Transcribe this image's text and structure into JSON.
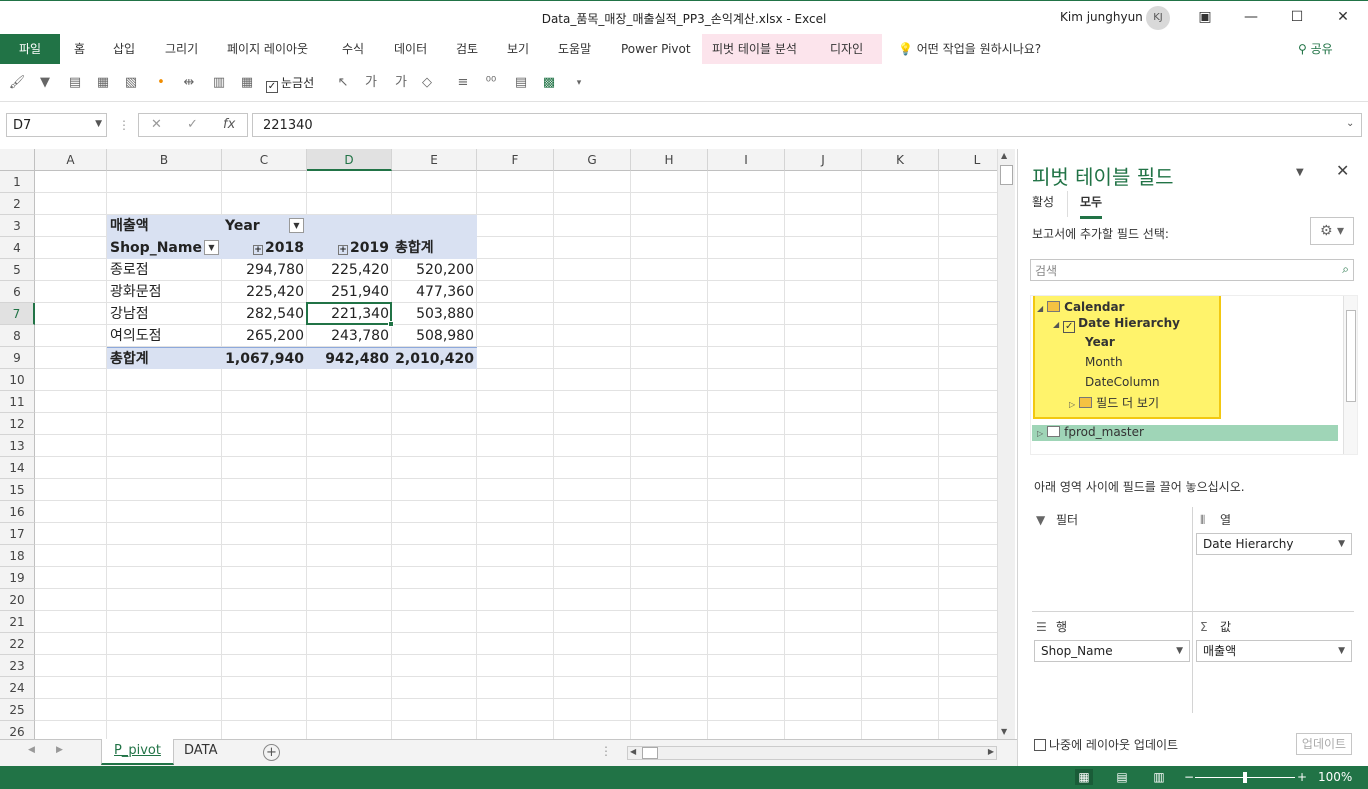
{
  "window": {
    "title": "Data_품목_매장_매출실적_PP3_손익계산.xlsx  -  Excel",
    "user": "Kim junghyun",
    "avatar": "KJ"
  },
  "ribbon": {
    "tabs": [
      "파일",
      "홈",
      "삽입",
      "그리기",
      "페이지 레이아웃",
      "수식",
      "데이터",
      "검토",
      "보기",
      "도움말",
      "Power Pivot",
      "피벗 테이블 분석",
      "디자인"
    ],
    "tell_me": "어떤 작업을 원하시나요?",
    "share": "공유"
  },
  "quick_toolbar": {
    "gridlines_label": "눈금선",
    "gridlines_checked": true
  },
  "formula_bar": {
    "name_box": "D7",
    "formula": "221340",
    "fx": "fx"
  },
  "sheet": {
    "columns": [
      "A",
      "B",
      "C",
      "D",
      "E",
      "F",
      "G",
      "H",
      "I",
      "J",
      "K",
      "L"
    ],
    "selected_column": "D",
    "rows": [
      "1",
      "2",
      "3",
      "4",
      "5",
      "6",
      "7",
      "8",
      "9",
      "10",
      "11",
      "12",
      "13",
      "14",
      "15",
      "16",
      "17",
      "18",
      "19",
      "20",
      "21",
      "22",
      "23",
      "24",
      "25",
      "26"
    ],
    "selected_row": "7",
    "pivot": {
      "value_header": "매출액",
      "col_field": "Year",
      "row_field": "Shop_Name",
      "col_labels": [
        "2018",
        "2019",
        "총합계"
      ],
      "rows": [
        {
          "name": "종로점",
          "v2018": "294,780",
          "v2019": "225,420",
          "total": "520,200"
        },
        {
          "name": "광화문점",
          "v2018": "225,420",
          "v2019": "251,940",
          "total": "477,360"
        },
        {
          "name": "강남점",
          "v2018": "282,540",
          "v2019": "221,340",
          "total": "503,880"
        },
        {
          "name": "여의도점",
          "v2018": "265,200",
          "v2019": "243,780",
          "total": "508,980"
        }
      ],
      "grand_total": {
        "name": "총합계",
        "v2018": "1,067,940",
        "v2019": "942,480",
        "total": "2,010,420"
      }
    }
  },
  "sheet_tabs": [
    "P_pivot",
    "DATA"
  ],
  "active_sheet": "P_pivot",
  "pivot_pane": {
    "title": "피벗 테이블 필드",
    "tabs": [
      "활성",
      "모두"
    ],
    "active_tab": "모두",
    "choose_label": "보고서에 추가할 필드 선택:",
    "search_placeholder": "검색",
    "fields": {
      "calendar": "Calendar",
      "date_hierarchy": "Date Hierarchy",
      "year": "Year",
      "month": "Month",
      "date_column": "DateColumn",
      "more_fields": "필드 더 보기",
      "fprod_master": "fprod_master"
    },
    "drag_hint": "아래 영역 사이에 필드를 끌어 놓으십시오.",
    "areas": {
      "filters_label": "필터",
      "columns_label": "열",
      "columns_value": "Date Hierarchy",
      "rows_label": "행",
      "rows_value": "Shop_Name",
      "values_label": "값",
      "values_value": "매출액"
    },
    "defer_label": "나중에 레이아웃 업데이트",
    "update_button": "업데이트"
  },
  "status_bar": {
    "zoom": "100%"
  },
  "colors": {
    "excel_green": "#217346",
    "pivot_header": "#d9e1f2",
    "highlight_yellow": "#fff36b"
  }
}
